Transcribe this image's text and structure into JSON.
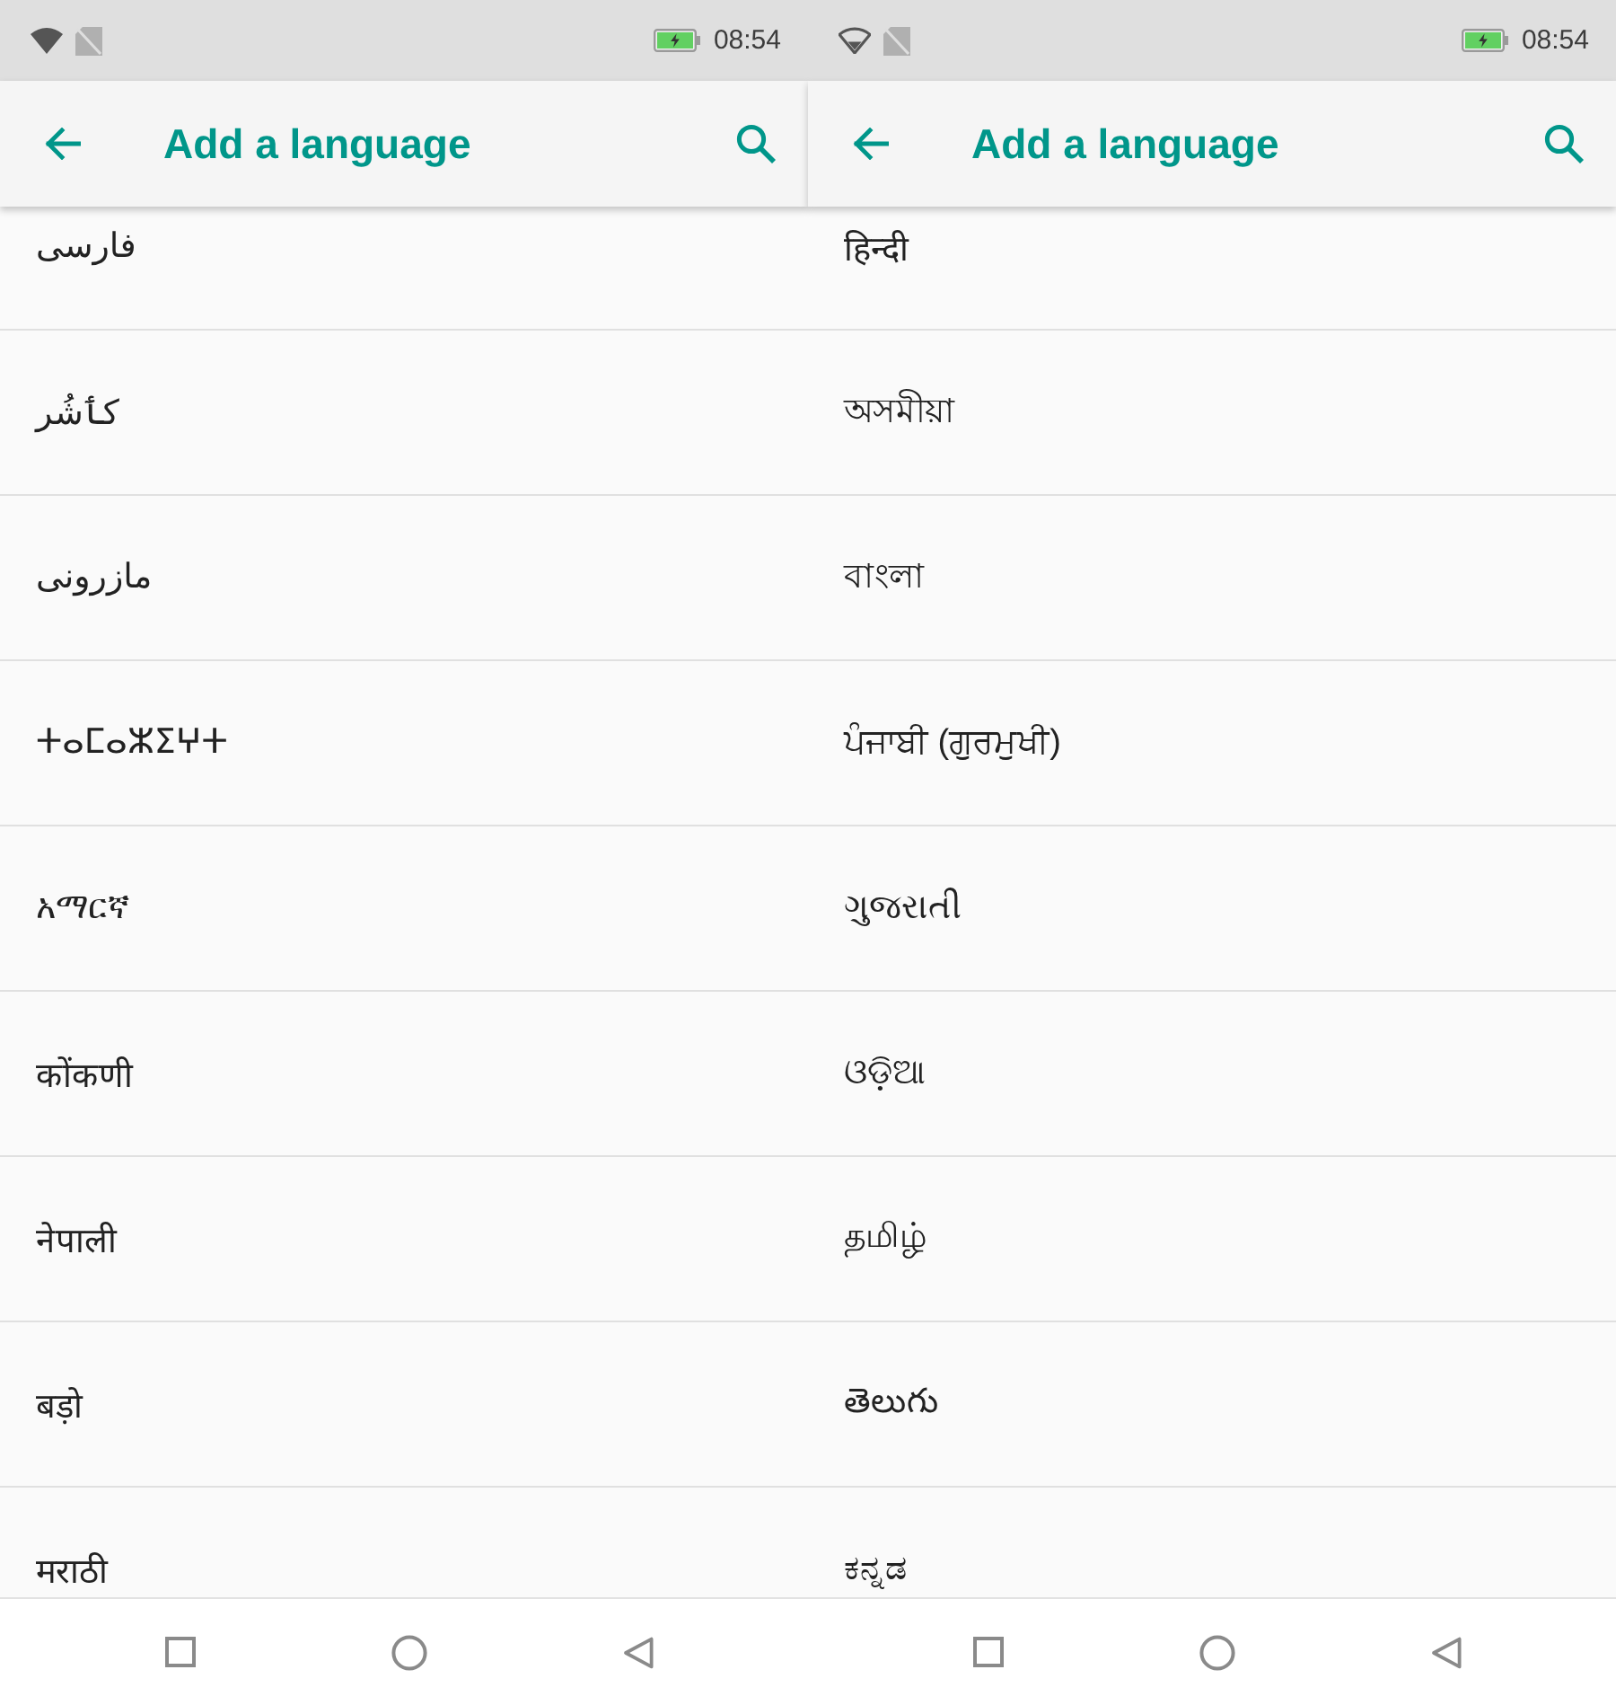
{
  "screens": [
    {
      "status_bar": {
        "wifi_limited": false,
        "charging": true,
        "time": "08:54"
      },
      "app_bar": {
        "title": "Add a language"
      },
      "languages": [
        "فارسی",
        "کٲشُر",
        "مازرونی",
        "ⵜⴰⵎⴰⵣⵉⵖⵜ",
        "አማርኛ",
        "कोंकणी",
        "नेपाली",
        "बड़ो",
        "मराठी"
      ]
    },
    {
      "status_bar": {
        "wifi_limited": true,
        "charging": true,
        "time": "08:54"
      },
      "app_bar": {
        "title": "Add a language"
      },
      "languages": [
        "हिन्दी",
        "অসমীয়া",
        "বাংলা",
        "ਪੰਜਾਬੀ (ਗੁਰਮੁਖੀ)",
        "ગુજરાતી",
        "ଓଡ଼ିଆ",
        "தமிழ்",
        "తెలుగు",
        "ಕನ್ನಡ"
      ]
    }
  ]
}
